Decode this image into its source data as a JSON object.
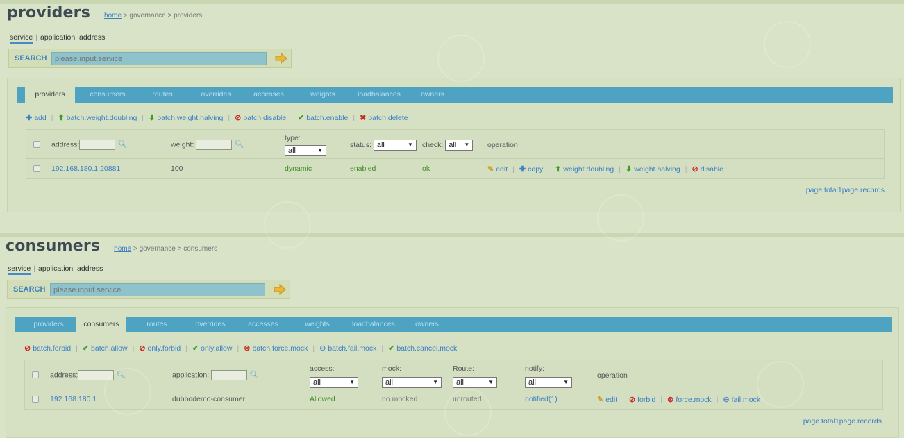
{
  "providers_page": {
    "title": "providers",
    "breadcrumb": {
      "home": "home",
      "rest": " > governance > providers"
    },
    "modes": {
      "service": "service",
      "application": "application",
      "address": "address"
    },
    "search": {
      "label": "SEARCH",
      "placeholder": "please.input.service"
    },
    "tabs": [
      "providers",
      "consumers",
      "routes",
      "overrides",
      "accesses",
      "weights",
      "loadbalances",
      "owners"
    ],
    "actions": {
      "add": "add",
      "weight_doubling": "batch.weight.doubling",
      "weight_halving": "batch.weight.halving",
      "disable": "batch.disable",
      "enable": "batch.enable",
      "delete": "batch.delete"
    },
    "columns": {
      "address": "address:",
      "weight": "weight:",
      "type": "type:",
      "type_value": "all",
      "status": "status:",
      "status_value": "all",
      "check": "check:",
      "check_value": "all",
      "operation": "operation"
    },
    "row": {
      "address": "192.168.180.1:20881",
      "weight": "100",
      "type": "dynamic",
      "status": "enabled",
      "check": "ok",
      "ops": {
        "edit": "edit",
        "copy": "copy",
        "doubling": "weight.doubling",
        "halving": "weight.halving",
        "disable": "disable"
      }
    },
    "paging": "page.total1page.records"
  },
  "consumers_page": {
    "title": "consumers",
    "breadcrumb": {
      "home": "home",
      "rest": " > governance > consumers"
    },
    "modes": {
      "service": "service",
      "application": "application",
      "address": "address"
    },
    "search": {
      "label": "SEARCH",
      "placeholder": "please.input.service"
    },
    "tabs": [
      "providers",
      "consumers",
      "routes",
      "overrides",
      "accesses",
      "weights",
      "loadbalances",
      "owners"
    ],
    "actions": {
      "forbid": "batch.forbid",
      "allow": "batch.allow",
      "only_forbid": "only.forbid",
      "only_allow": "only.allow",
      "force_mock": "batch.force.mock",
      "fail_mock": "batch.fail.mock",
      "cancel_mock": "batch.cancel.mock"
    },
    "columns": {
      "address": "address:",
      "application": "application:",
      "access": "access:",
      "access_value": "all",
      "mock": "mock:",
      "mock_value": "all",
      "route": "Route:",
      "route_value": "all",
      "notify": "notify:",
      "notify_value": "all",
      "operation": "operation"
    },
    "row": {
      "address": "192.168.180.1",
      "application": "dubbodemo-consumer",
      "access": "Allowed",
      "mock": "no.mocked",
      "route": "unrouted",
      "notify": "notified(1)",
      "ops": {
        "edit": "edit",
        "forbid": "forbid",
        "force_mock": "force.mock",
        "fail_mock": "fail.mock"
      }
    },
    "paging": "page.total1page.records"
  }
}
